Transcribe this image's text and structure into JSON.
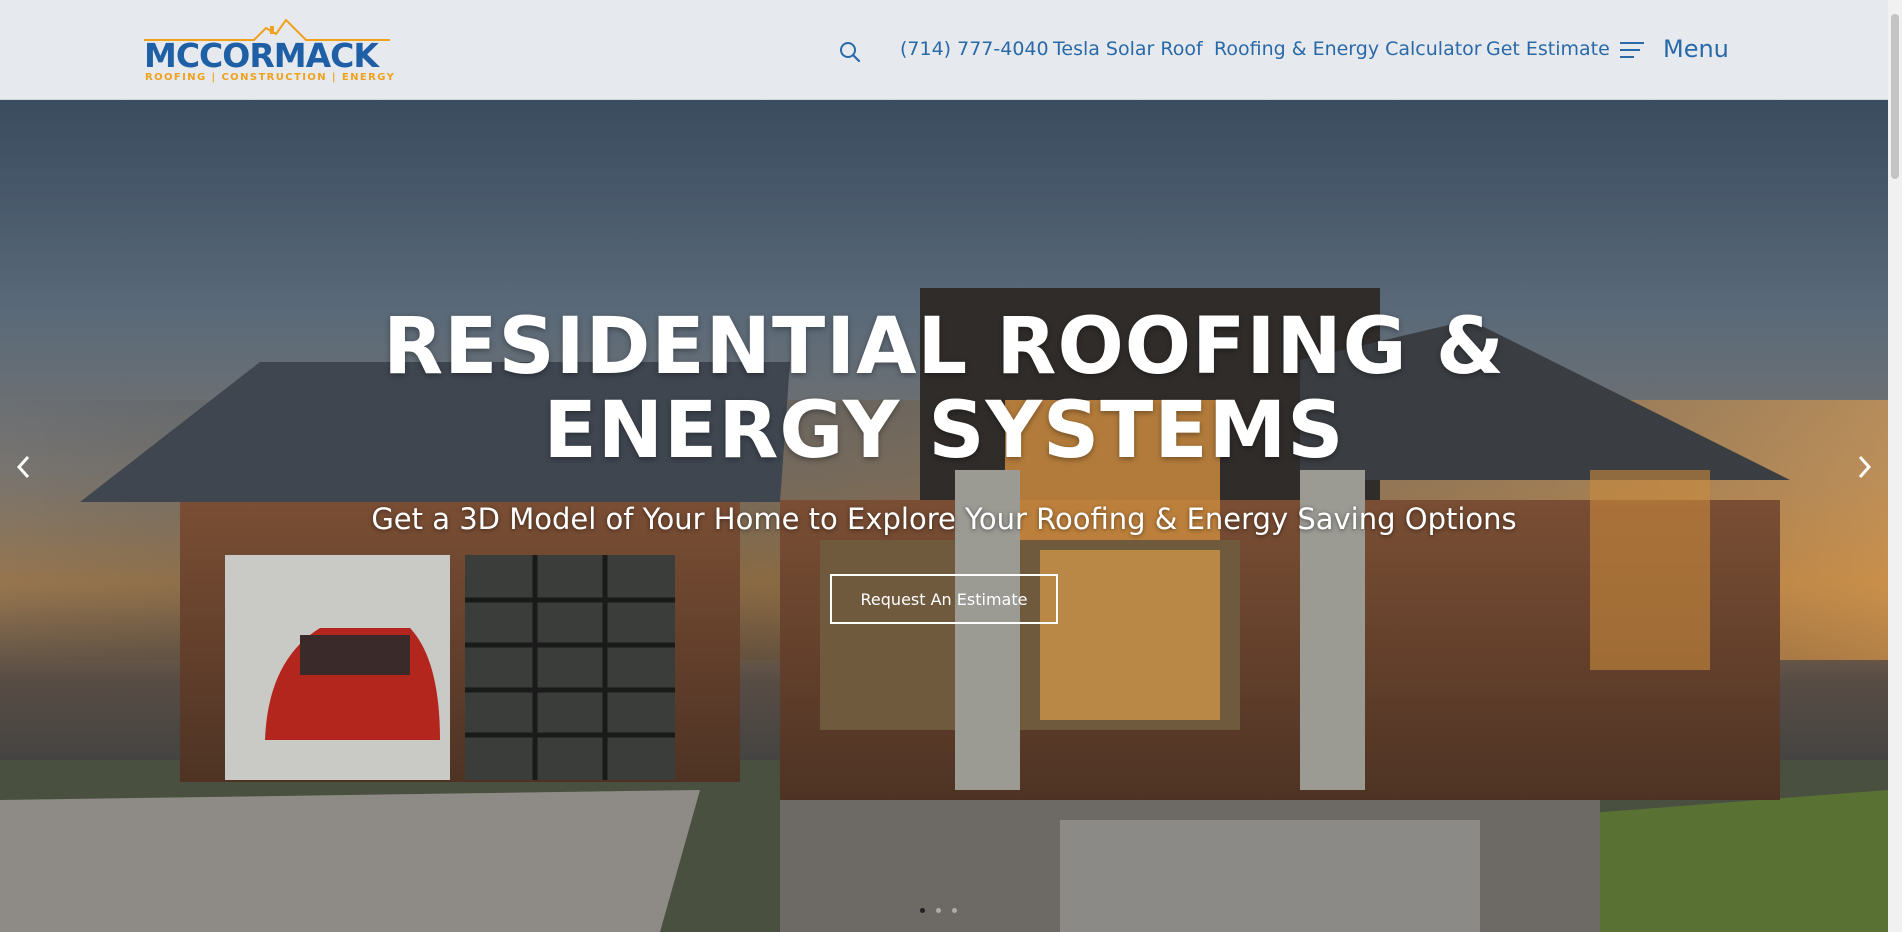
{
  "brand": {
    "name": "MCCORMACK",
    "tagline": "ROOFING | CONSTRUCTION | ENERGY",
    "colors": {
      "primary": "#1f5fa5",
      "accent": "#f0a11d",
      "link": "#2a69a8"
    }
  },
  "nav": {
    "search_icon": "search-icon",
    "phone": "(714) 777-4040",
    "tesla": "Tesla Solar Roof",
    "calculator": "Roofing & Energy Calculator",
    "estimate": "Get Estimate",
    "menu_icon": "hamburger-icon",
    "menu_label": "Menu"
  },
  "hero": {
    "title_line1": "RESIDENTIAL ROOFING &",
    "title_line2": "ENERGY SYSTEMS",
    "subtitle": "Get a 3D Model of Your Home to Explore Your Roofing & Energy Saving Options",
    "cta_label": "Request An Estimate",
    "prev_icon": "chevron-left-icon",
    "next_icon": "chevron-right-icon",
    "slides_count": 3,
    "active_slide": 1
  }
}
